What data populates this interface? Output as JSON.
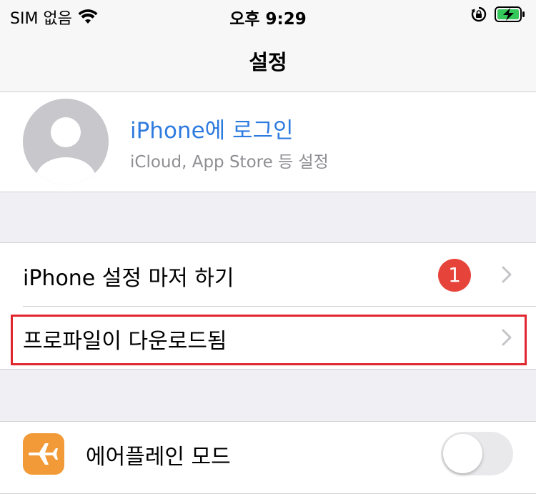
{
  "status_bar": {
    "carrier": "SIM 없음",
    "time": "오후 9:29",
    "icons": [
      "wifi-icon",
      "orientation-lock-icon",
      "battery-charging-icon"
    ],
    "battery_color": "#35c759"
  },
  "nav": {
    "title": "설정"
  },
  "profile": {
    "title": "iPhone에 로그인",
    "subtitle": "iCloud, App Store 등 설정",
    "title_color": "#2e7bdf",
    "icon": "person-avatar-icon"
  },
  "rows": {
    "setup": {
      "label": "iPhone 설정 마저 하기",
      "badge": "1",
      "badge_color": "#e6443a"
    },
    "profile_downloaded": {
      "label": "프로파일이 다운로드됨",
      "highlight_color": "#e0262e"
    },
    "airplane": {
      "label": "에어플레인 모드",
      "icon": "airplane-icon",
      "icon_color": "#f19a37",
      "toggle_on": false
    }
  }
}
